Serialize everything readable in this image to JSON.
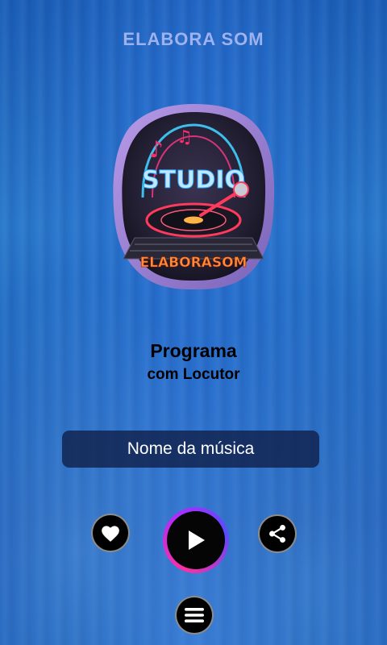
{
  "header": {
    "title": "ELABORA SOM"
  },
  "logo": {
    "text_top": "STUDIO",
    "text_bottom": "ELABORASOM"
  },
  "program": {
    "title": "Programa",
    "subtitle": "com Locutor"
  },
  "now_playing": {
    "song": "Nome da música"
  },
  "controls": {
    "favorite_icon": "heart-icon",
    "play_icon": "play-icon",
    "share_icon": "share-icon",
    "menu_icon": "hamburger-menu-icon"
  },
  "colors": {
    "title": "#9db2ee",
    "play_ring": "#ff2fa0",
    "song_box": "#101e46"
  }
}
